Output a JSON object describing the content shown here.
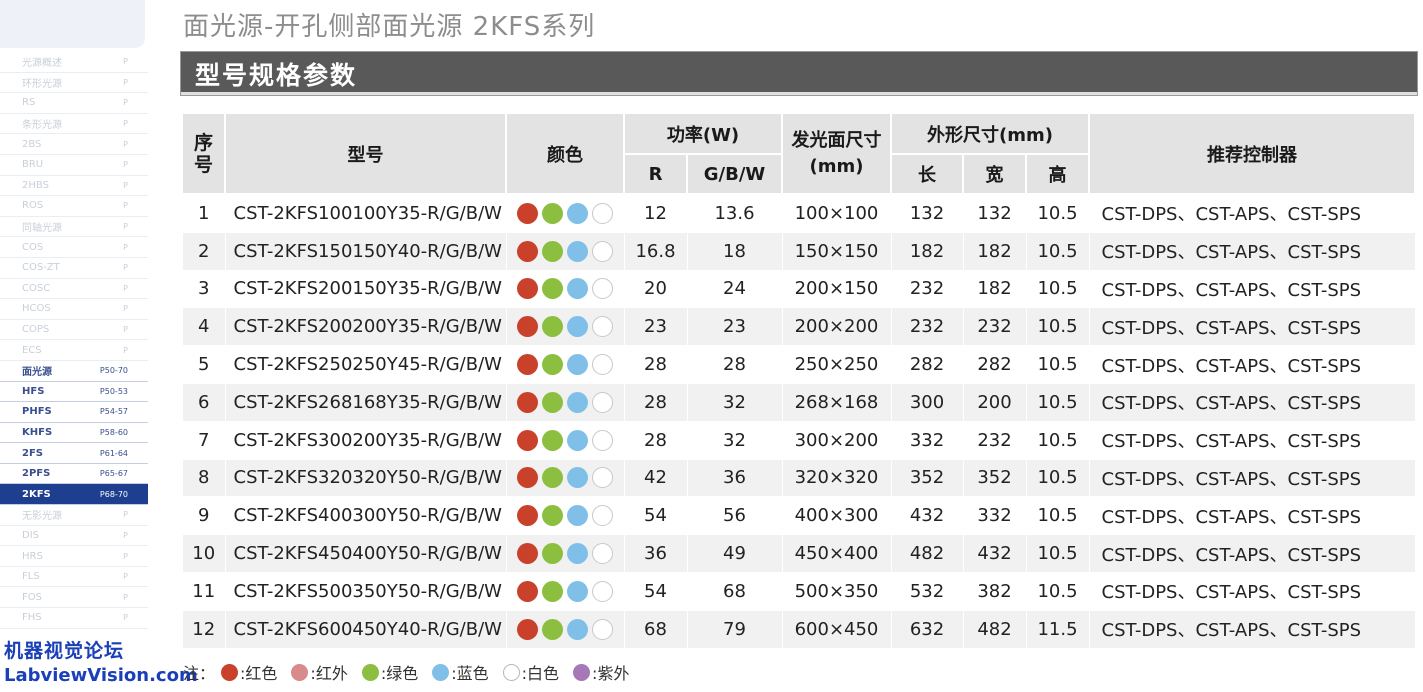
{
  "title": "面光源-开孔侧部面光源 2KFS系列",
  "section_title": "型号规格参数",
  "sidebar": [
    {
      "label": "光源概述",
      "page": "P",
      "style": "light"
    },
    {
      "label": "环形光源",
      "page": "P",
      "style": "light"
    },
    {
      "label": "RS",
      "page": "P",
      "style": "light"
    },
    {
      "label": "条形光源",
      "page": "P",
      "style": "light"
    },
    {
      "label": "2BS",
      "page": "P",
      "style": "light"
    },
    {
      "label": "BRU",
      "page": "P",
      "style": "light"
    },
    {
      "label": "2HBS",
      "page": "P",
      "style": "light"
    },
    {
      "label": "ROS",
      "page": "P",
      "style": "light"
    },
    {
      "label": "同轴光源",
      "page": "P",
      "style": "light"
    },
    {
      "label": "COS",
      "page": "P",
      "style": "light"
    },
    {
      "label": "COS-ZT",
      "page": "P",
      "style": "light"
    },
    {
      "label": "COSC",
      "page": "P",
      "style": "light"
    },
    {
      "label": "HCOS",
      "page": "P",
      "style": "light"
    },
    {
      "label": "COPS",
      "page": "P",
      "style": "light"
    },
    {
      "label": "ECS",
      "page": "P",
      "style": "light"
    },
    {
      "label": "面光源",
      "page": "P50-70",
      "style": "dark"
    },
    {
      "label": "HFS",
      "page": "P50-53",
      "style": "dark"
    },
    {
      "label": "PHFS",
      "page": "P54-57",
      "style": "dark"
    },
    {
      "label": "KHFS",
      "page": "P58-60",
      "style": "dark"
    },
    {
      "label": "2FS",
      "page": "P61-64",
      "style": "dark"
    },
    {
      "label": "2PFS",
      "page": "P65-67",
      "style": "dark"
    },
    {
      "label": "2KFS",
      "page": "P68-70",
      "style": "active"
    },
    {
      "label": "无影光源",
      "page": "P",
      "style": "light"
    },
    {
      "label": "DIS",
      "page": "P",
      "style": "light"
    },
    {
      "label": "HRS",
      "page": "P",
      "style": "light"
    },
    {
      "label": "FLS",
      "page": "P",
      "style": "light"
    },
    {
      "label": "FOS",
      "page": "P",
      "style": "light"
    },
    {
      "label": "FHS",
      "page": "P",
      "style": "light"
    }
  ],
  "watermark": {
    "cn": "机器视觉论坛",
    "en": "LabviewVision.com"
  },
  "table": {
    "headers": {
      "no": "序号",
      "model": "型号",
      "color": "颜色",
      "power": "功率(W)",
      "power_r": "R",
      "power_gbw": "G/B/W",
      "emit_size": "发光面尺寸(mm)",
      "outer_size": "外形尺寸(mm)",
      "len": "长",
      "wid": "宽",
      "hei": "高",
      "controller": "推荐控制器"
    },
    "rows": [
      {
        "no": "1",
        "model": "CST-2KFS100100Y35-R/G/B/W",
        "r": "12",
        "gbw": "13.6",
        "emit": "100×100",
        "l": "132",
        "w": "132",
        "h": "10.5",
        "ctrl": "CST-DPS、CST-APS、CST-SPS"
      },
      {
        "no": "2",
        "model": "CST-2KFS150150Y40-R/G/B/W",
        "r": "16.8",
        "gbw": "18",
        "emit": "150×150",
        "l": "182",
        "w": "182",
        "h": "10.5",
        "ctrl": "CST-DPS、CST-APS、CST-SPS"
      },
      {
        "no": "3",
        "model": "CST-2KFS200150Y35-R/G/B/W",
        "r": "20",
        "gbw": "24",
        "emit": "200×150",
        "l": "232",
        "w": "182",
        "h": "10.5",
        "ctrl": "CST-DPS、CST-APS、CST-SPS"
      },
      {
        "no": "4",
        "model": "CST-2KFS200200Y35-R/G/B/W",
        "r": "23",
        "gbw": "23",
        "emit": "200×200",
        "l": "232",
        "w": "232",
        "h": "10.5",
        "ctrl": "CST-DPS、CST-APS、CST-SPS"
      },
      {
        "no": "5",
        "model": "CST-2KFS250250Y45-R/G/B/W",
        "r": "28",
        "gbw": "28",
        "emit": "250×250",
        "l": "282",
        "w": "282",
        "h": "10.5",
        "ctrl": "CST-DPS、CST-APS、CST-SPS"
      },
      {
        "no": "6",
        "model": "CST-2KFS268168Y35-R/G/B/W",
        "r": "28",
        "gbw": "32",
        "emit": "268×168",
        "l": "300",
        "w": "200",
        "h": "10.5",
        "ctrl": "CST-DPS、CST-APS、CST-SPS"
      },
      {
        "no": "7",
        "model": "CST-2KFS300200Y35-R/G/B/W",
        "r": "28",
        "gbw": "32",
        "emit": "300×200",
        "l": "332",
        "w": "232",
        "h": "10.5",
        "ctrl": "CST-DPS、CST-APS、CST-SPS"
      },
      {
        "no": "8",
        "model": "CST-2KFS320320Y50-R/G/B/W",
        "r": "42",
        "gbw": "36",
        "emit": "320×320",
        "l": "352",
        "w": "352",
        "h": "10.5",
        "ctrl": "CST-DPS、CST-APS、CST-SPS"
      },
      {
        "no": "9",
        "model": "CST-2KFS400300Y50-R/G/B/W",
        "r": "54",
        "gbw": "56",
        "emit": "400×300",
        "l": "432",
        "w": "332",
        "h": "10.5",
        "ctrl": "CST-DPS、CST-APS、CST-SPS"
      },
      {
        "no": "10",
        "model": "CST-2KFS450400Y50-R/G/B/W",
        "r": "36",
        "gbw": "49",
        "emit": "450×400",
        "l": "482",
        "w": "432",
        "h": "10.5",
        "ctrl": "CST-DPS、CST-APS、CST-SPS"
      },
      {
        "no": "11",
        "model": "CST-2KFS500350Y50-R/G/B/W",
        "r": "54",
        "gbw": "68",
        "emit": "500×350",
        "l": "532",
        "w": "382",
        "h": "10.5",
        "ctrl": "CST-DPS、CST-APS、CST-SPS"
      },
      {
        "no": "12",
        "model": "CST-2KFS600450Y40-R/G/B/W",
        "r": "68",
        "gbw": "79",
        "emit": "600×450",
        "l": "632",
        "w": "482",
        "h": "11.5",
        "ctrl": "CST-DPS、CST-APS、CST-SPS"
      }
    ],
    "color_dots": [
      "#c9402b",
      "#8cbf3f",
      "#7fbfe8",
      "#ffffff"
    ]
  },
  "legend": {
    "prefix": "注：",
    "items": [
      {
        "color": "#c9402b",
        "label": ":红色"
      },
      {
        "color": "#d98a8a",
        "label": ":红外"
      },
      {
        "color": "#8cbf3f",
        "label": ":绿色"
      },
      {
        "color": "#7fbfe8",
        "label": ":蓝色"
      },
      {
        "color": "#ffffff",
        "label": ":白色"
      },
      {
        "color": "#a678b8",
        "label": ":紫外"
      }
    ]
  }
}
